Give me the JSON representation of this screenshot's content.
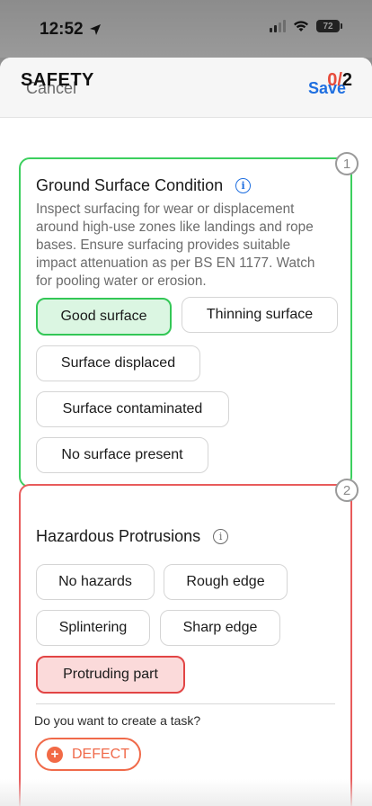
{
  "status_bar": {
    "time": "12:52",
    "battery": "72"
  },
  "header": {
    "cancel_label": "Cancel",
    "save_label": "Save"
  },
  "section": {
    "title": "SAFETY",
    "done": "0",
    "slash": "/",
    "total": "2"
  },
  "questions": [
    {
      "number": "1",
      "title": "Ground Surface Condition",
      "description": "Inspect surfacing for wear or displacement around high-use zones like landings and rope bases. Ensure surfacing provides suitable impact attenuation as per BS EN 1177. Watch for pooling water or erosion.",
      "options": [
        "Good surface",
        "Thinning surface",
        "Surface displaced",
        "Surface contaminated",
        "No surface present"
      ],
      "selected": "Good surface",
      "status_color": "#3ccf5e"
    },
    {
      "number": "2",
      "title": "Hazardous Protrusions",
      "options": [
        "No hazards",
        "Rough edge",
        "Splintering",
        "Sharp edge",
        "Protruding part"
      ],
      "selected": "Protruding part",
      "status_color": "#e85b5b",
      "task_question": "Do you want to create a task?",
      "task_button": "DEFECT"
    }
  ],
  "colors": {
    "accent": "#1f6fe0",
    "defect": "#f06a4a"
  }
}
